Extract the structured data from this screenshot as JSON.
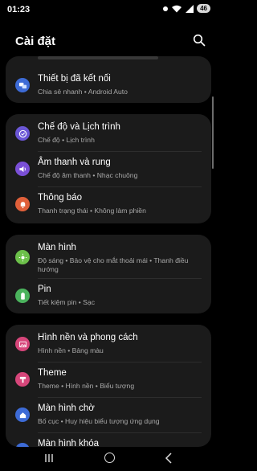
{
  "status": {
    "time": "01:23",
    "battery": "46"
  },
  "header": {
    "title": "Cài đặt"
  },
  "cards": [
    {
      "items": [
        {
          "label": "Thiết bị đã kết nối",
          "sub": "Chia sẻ nhanh • Android Auto",
          "icon": "link-devices-icon",
          "color": "#3d6bd6"
        }
      ]
    },
    {
      "items": [
        {
          "label": "Chế độ và Lịch trình",
          "sub": "Chế độ • Lịch trình",
          "icon": "check-circle-icon",
          "color": "#6b57d6"
        },
        {
          "label": "Âm thanh và rung",
          "sub": "Chế độ âm thanh • Nhạc chuông",
          "icon": "speaker-icon",
          "color": "#7a4fd6"
        },
        {
          "label": "Thông báo",
          "sub": "Thanh trạng thái • Không làm phiền",
          "icon": "bell-icon",
          "color": "#e0603a"
        }
      ]
    },
    {
      "items": [
        {
          "label": "Màn hình",
          "sub": "Độ sáng • Bảo vệ cho mắt thoải mái • Thanh điều hướng",
          "icon": "sun-icon",
          "color": "#6cc04a"
        },
        {
          "label": "Pin",
          "sub": "Tiết kiệm pin • Sạc",
          "icon": "battery-icon",
          "color": "#4bb35d"
        }
      ]
    },
    {
      "items": [
        {
          "label": "Hình nền và phong cách",
          "sub": "Hình nền • Bảng màu",
          "icon": "image-icon",
          "color": "#d6467a"
        },
        {
          "label": "Theme",
          "sub": "Theme • Hình nền • Biểu tượng",
          "icon": "theme-icon",
          "color": "#d6467a"
        },
        {
          "label": "Màn hình chờ",
          "sub": "Bố cục • Huy hiệu biểu tượng ứng dụng",
          "icon": "home-icon",
          "color": "#3d6bd6"
        },
        {
          "label": "Màn hình khóa",
          "sub": "",
          "icon": "lock-icon",
          "color": "#3d6bd6"
        }
      ]
    }
  ]
}
